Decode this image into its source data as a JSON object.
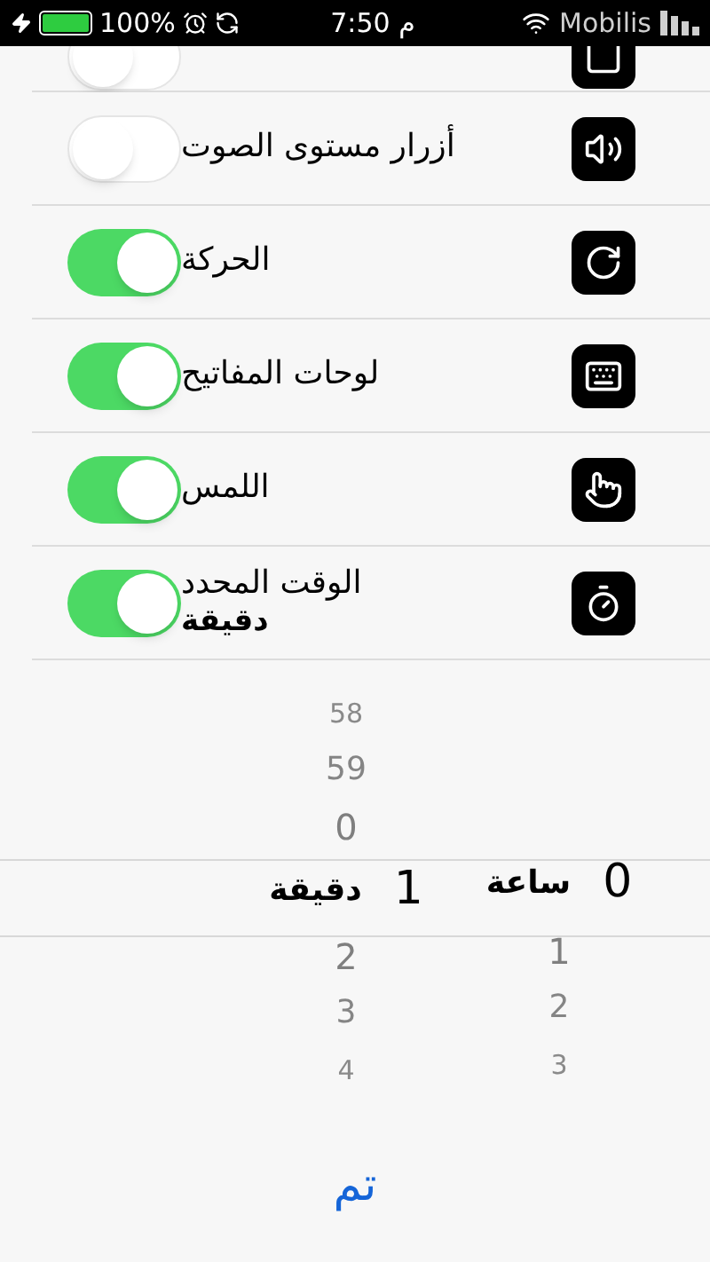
{
  "status_bar": {
    "battery": "100%",
    "time": "م 7:50",
    "carrier": "Mobilis"
  },
  "settings": [
    {
      "on": false
    },
    {
      "label": "أزرار مستوى الصوت",
      "on": false
    },
    {
      "label": "الحركة",
      "on": true
    },
    {
      "label": "لوحات المفاتيح",
      "on": true
    },
    {
      "label": "اللمس",
      "on": true
    },
    {
      "label": "الوقت المحدد",
      "detail": "دقيقة",
      "on": true
    }
  ],
  "picker": {
    "columns": [
      {
        "unit": "ساعة",
        "value": "0",
        "below": [
          "1",
          "2",
          "3"
        ]
      },
      {
        "unit": "دقيقة",
        "above": [
          "58",
          "59",
          "0"
        ],
        "value": "1",
        "below": [
          "2",
          "3",
          "4"
        ]
      }
    ]
  },
  "done_button": "تم"
}
